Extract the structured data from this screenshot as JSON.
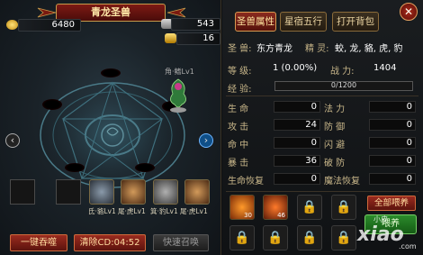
{
  "header": {
    "title": "青龙圣兽",
    "coins": "6480",
    "gold": "543",
    "gems": "16"
  },
  "pet": {
    "label": "角·鳍Lv1"
  },
  "equipment": [
    {
      "label": ""
    },
    {
      "label": ""
    },
    {
      "label": "氐·貉Lv1"
    },
    {
      "label": "尾·虎Lv1"
    },
    {
      "label": "箕·豹Lv1"
    },
    {
      "label": "尾·虎Lv1"
    }
  ],
  "buttons": {
    "devour": "一键吞噬",
    "clear_cd": "清除CD:04:52",
    "quick_summon": "快速召唤",
    "feed_all": "全部喂养",
    "feed": "喂养"
  },
  "tabs": {
    "attributes": "圣兽属性",
    "constellations": "星宿五行",
    "open_bag": "打开背包",
    "close": "✕"
  },
  "info": {
    "beast_label": "圣 兽:",
    "beast_value": "东方青龙",
    "spirit_label": "精 灵:",
    "spirit_value": "蛟, 龙, 貉, 虎, 豹",
    "level_label": "等 级:",
    "level_value": "1 (0.00%)",
    "power_label": "战 力:",
    "power_value": "1404",
    "exp_label": "经 验:",
    "exp_value": "0/1200",
    "exp_fraction": 0.0
  },
  "stats": [
    {
      "left_label": "生 命",
      "left_value": "0",
      "right_label": "法 力",
      "right_value": "0"
    },
    {
      "left_label": "攻 击",
      "left_value": "24",
      "right_label": "防 御",
      "right_value": "0"
    },
    {
      "left_label": "命 中",
      "left_value": "0",
      "right_label": "闪 避",
      "right_value": "0"
    },
    {
      "left_label": "暴 击",
      "left_value": "36",
      "right_label": "破 防",
      "right_value": "0"
    },
    {
      "left_label": "生命恢复",
      "left_value": "0",
      "right_label": "魔法恢复",
      "right_value": "0"
    }
  ],
  "runes": [
    {
      "count": "30"
    },
    {
      "count": "46"
    }
  ],
  "watermark": {
    "text": "xiao",
    "sub": "小皮",
    "domain": ".com"
  },
  "colors": {
    "accent_red": "#8a2b1f",
    "gold_border": "#d79a50",
    "feed_green": "#2b8b2b"
  }
}
